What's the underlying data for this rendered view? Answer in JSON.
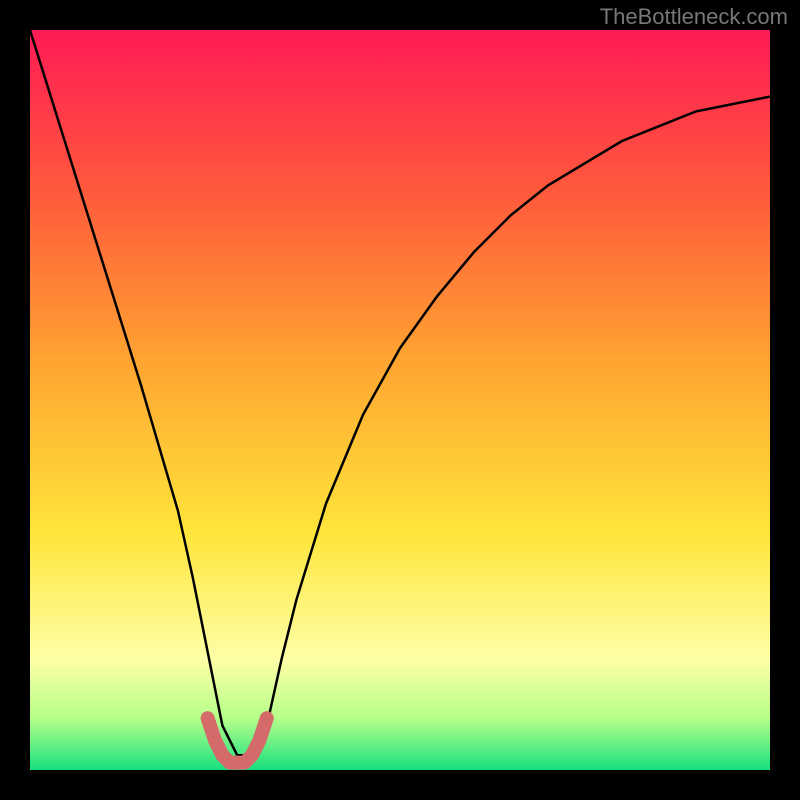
{
  "watermark": "TheBottleneck.com",
  "chart_data": {
    "type": "line",
    "title": "",
    "xlabel": "",
    "ylabel": "",
    "xlim": [
      0,
      100
    ],
    "ylim": [
      0,
      100
    ],
    "series": [
      {
        "name": "curve",
        "x": [
          0,
          5,
          10,
          15,
          20,
          22,
          24,
          26,
          28,
          30,
          32,
          34,
          36,
          40,
          45,
          50,
          55,
          60,
          65,
          70,
          75,
          80,
          85,
          90,
          95,
          100
        ],
        "values": [
          100,
          84,
          68,
          52,
          35,
          26,
          16,
          6,
          2,
          2,
          6,
          15,
          23,
          36,
          48,
          57,
          64,
          70,
          75,
          79,
          82,
          85,
          87,
          89,
          90,
          91
        ]
      },
      {
        "name": "highlight",
        "x": [
          24,
          25,
          26,
          27,
          28,
          29,
          30,
          31,
          32
        ],
        "values": [
          7,
          4,
          2,
          1,
          1,
          1,
          2,
          4,
          7
        ]
      }
    ],
    "colors": {
      "curve": "#000000",
      "highlight": "#d46a6a"
    },
    "background": "vertical gradient red→orange→yellow→pale-yellow→green",
    "gradient_stops": [
      {
        "pos": 0.0,
        "color": "#ff1a55"
      },
      {
        "pos": 0.22,
        "color": "#ff5a3c"
      },
      {
        "pos": 0.45,
        "color": "#ffa531"
      },
      {
        "pos": 0.68,
        "color": "#ffe53b"
      },
      {
        "pos": 0.85,
        "color": "#feffa6"
      },
      {
        "pos": 0.93,
        "color": "#b6ff8a"
      },
      {
        "pos": 1.0,
        "color": "#18e07f"
      }
    ]
  }
}
